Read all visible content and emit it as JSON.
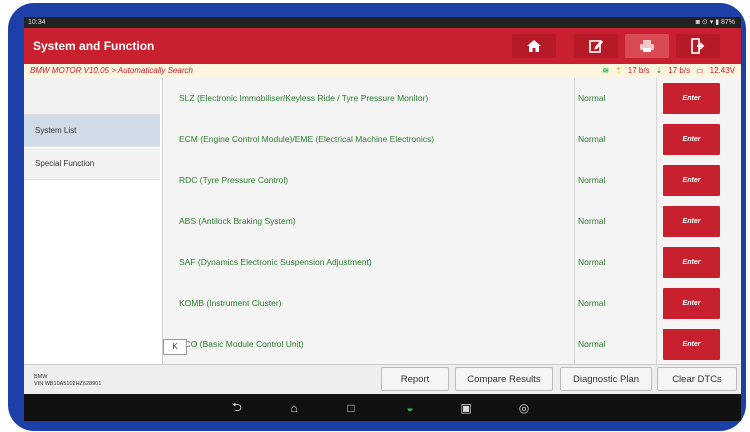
{
  "status": {
    "time": "10:34",
    "indicators": "◙ ⊙ ▾ ▮ 87%"
  },
  "header": {
    "title": "System and Function",
    "icons": [
      "home-icon",
      "edit-icon",
      "print-icon",
      "exit-icon"
    ]
  },
  "subbar": {
    "path": "BMW MOTOR V10.05 > Automatically Search",
    "up_rate": "17 b/s",
    "down_rate": "17 b/s",
    "voltage": "12.43V"
  },
  "sidebar": {
    "items": [
      {
        "label": ""
      },
      {
        "label": "System List"
      },
      {
        "label": "Special Function"
      }
    ]
  },
  "systems": [
    {
      "name": "SLZ (Electronic Immobiliser/Keyless Ride / Tyre Pressure Monitor)",
      "status": "Normal",
      "action": "Enter"
    },
    {
      "name": "ECM (Engine Control Module)/EME (Electrical Machine Electronics)",
      "status": "Normal",
      "action": "Enter"
    },
    {
      "name": "RDC (Tyre Pressure Control)",
      "status": "Normal",
      "action": "Enter"
    },
    {
      "name": "ABS (Antilock Braking System)",
      "status": "Normal",
      "action": "Enter"
    },
    {
      "name": "SAF (Dynamics Electronic Suspension Adjustment)",
      "status": "Normal",
      "action": "Enter"
    },
    {
      "name": "KOMB (Instrument Cluster)",
      "status": "Normal",
      "action": "Enter"
    },
    {
      "name": "BCO (Basic Module Control Unit)",
      "status": "Normal",
      "action": "Enter"
    }
  ],
  "collapse": {
    "label": "K"
  },
  "vehicle": {
    "make": "BMW",
    "vin": "VIN WB10A5102HZ628901"
  },
  "footer": {
    "report": "Report",
    "compare": "Compare Results",
    "plan": "Diagnostic Plan",
    "clear": "Clear DTCs"
  },
  "colors": {
    "brand": "#c8202e",
    "text_ok": "#2e7d32",
    "frame": "#1d3fa8"
  }
}
